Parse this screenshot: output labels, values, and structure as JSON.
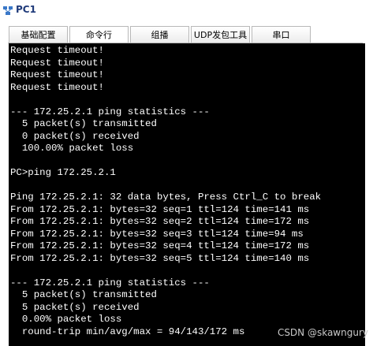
{
  "window": {
    "title": "PC1",
    "icon": "pc-network-icon"
  },
  "tabs": [
    {
      "label": "基础配置",
      "active": false
    },
    {
      "label": "命令行",
      "active": true
    },
    {
      "label": "组播",
      "active": false
    },
    {
      "label": "UDP发包工具",
      "active": false
    },
    {
      "label": "串口",
      "active": false
    }
  ],
  "terminal": {
    "lines": [
      "Request timeout!",
      "Request timeout!",
      "Request timeout!",
      "Request timeout!",
      "",
      "--- 172.25.2.1 ping statistics ---",
      "  5 packet(s) transmitted",
      "  0 packet(s) received",
      "  100.00% packet loss",
      "",
      "PC>ping 172.25.2.1",
      "",
      "Ping 172.25.2.1: 32 data bytes, Press Ctrl_C to break",
      "From 172.25.2.1: bytes=32 seq=1 ttl=124 time=141 ms",
      "From 172.25.2.1: bytes=32 seq=2 ttl=124 time=172 ms",
      "From 172.25.2.1: bytes=32 seq=3 ttl=124 time=94 ms",
      "From 172.25.2.1: bytes=32 seq=4 ttl=124 time=172 ms",
      "From 172.25.2.1: bytes=32 seq=5 ttl=124 time=140 ms",
      "",
      "--- 172.25.2.1 ping statistics ---",
      "  5 packet(s) transmitted",
      "  5 packet(s) received",
      "  0.00% packet loss",
      "  round-trip min/avg/max = 94/143/172 ms"
    ]
  },
  "watermark": "CSDN @skawngury",
  "colors": {
    "terminal_bg": "#000000",
    "terminal_fg": "#ffffff",
    "title_color": "#1f3a7a"
  }
}
